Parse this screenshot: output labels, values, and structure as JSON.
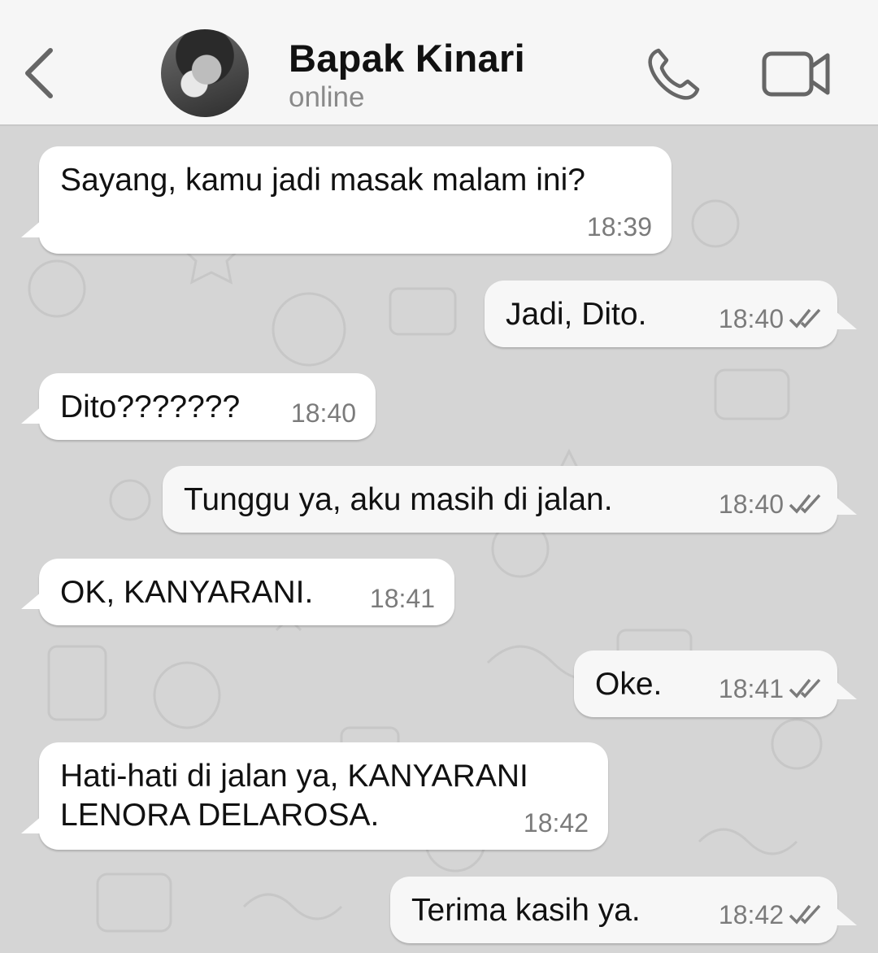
{
  "header": {
    "contact_name": "Bapak Kinari",
    "status": "online",
    "icons": {
      "back": "chevron-left-icon",
      "call": "phone-icon",
      "video": "video-camera-icon"
    }
  },
  "colors": {
    "header_bg": "#f6f6f6",
    "chat_bg": "#d5d5d5",
    "bubble_in": "#ffffff",
    "bubble_out": "#f7f7f7",
    "timestamp": "#7b7b7b",
    "status_text": "#8a8a8a"
  },
  "messages": [
    {
      "direction": "incoming",
      "text": "Sayang, kamu jadi masak malam ini?",
      "time": "18:39"
    },
    {
      "direction": "outgoing",
      "text": "Jadi, Dito.",
      "time": "18:40",
      "status_icon": "double-check-icon"
    },
    {
      "direction": "incoming",
      "text": "Dito???????",
      "time": "18:40"
    },
    {
      "direction": "outgoing",
      "text": "Tunggu ya, aku masih di jalan.",
      "time": "18:40",
      "status_icon": "double-check-icon"
    },
    {
      "direction": "incoming",
      "text": "OK, KANYARANI.",
      "time": "18:41"
    },
    {
      "direction": "outgoing",
      "text": "Oke.",
      "time": "18:41",
      "status_icon": "double-check-icon"
    },
    {
      "direction": "incoming",
      "text_line1": "Hati-hati di jalan ya, KANYARANI",
      "text_line2": "LENORA DELAROSA.",
      "time": "18:42"
    },
    {
      "direction": "outgoing",
      "text": "Terima kasih ya.",
      "time": "18:42",
      "status_icon": "double-check-icon"
    }
  ]
}
